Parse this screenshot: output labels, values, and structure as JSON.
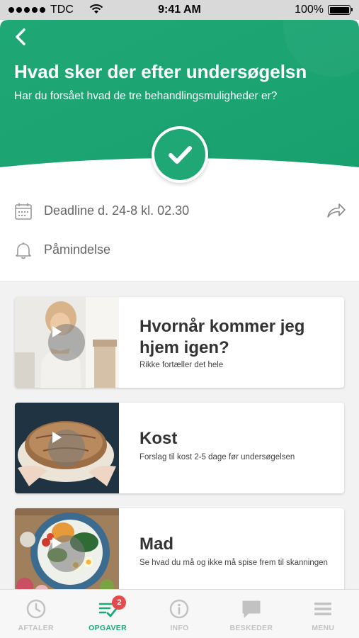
{
  "status_bar": {
    "carrier": "TDC",
    "time": "9:41 AM",
    "battery": "100%"
  },
  "header": {
    "title": "Hvad sker der efter undersøgelsn",
    "subtitle": "Har du forsået hvad de tre behandlingsmuligheder er?",
    "accent_color": "#1fa876",
    "back_icon": "chevron-left-icon",
    "complete_icon": "checkmark-icon"
  },
  "details": {
    "deadline": "Deadline d. 24-8 kl. 02.30",
    "reminder": "Påmindelse",
    "deadline_icon": "calendar-icon",
    "reminder_icon": "bell-icon",
    "share_icon": "share-arrow-icon"
  },
  "cards": [
    {
      "title": "Hvornår kommer jeg hjem igen?",
      "subtitle": "Rikke fortæller det hele",
      "has_video": true
    },
    {
      "title": "Kost",
      "subtitle": "Forslag til kost 2-5 dage før undersøgelsen",
      "has_video": true
    },
    {
      "title": "Mad",
      "subtitle": "Se hvad du må og ikke må spise frem til skanningen",
      "has_video": true
    }
  ],
  "tabs": [
    {
      "label": "AFTALER",
      "icon": "clock-icon",
      "active": false
    },
    {
      "label": "OPGAVER",
      "icon": "task-list-check-icon",
      "active": true,
      "badge": "2"
    },
    {
      "label": "INFO",
      "icon": "info-icon",
      "active": false
    },
    {
      "label": "BESKEDER",
      "icon": "chat-bubble-icon",
      "active": false
    },
    {
      "label": "MENU",
      "icon": "hamburger-menu-icon",
      "active": false
    }
  ]
}
